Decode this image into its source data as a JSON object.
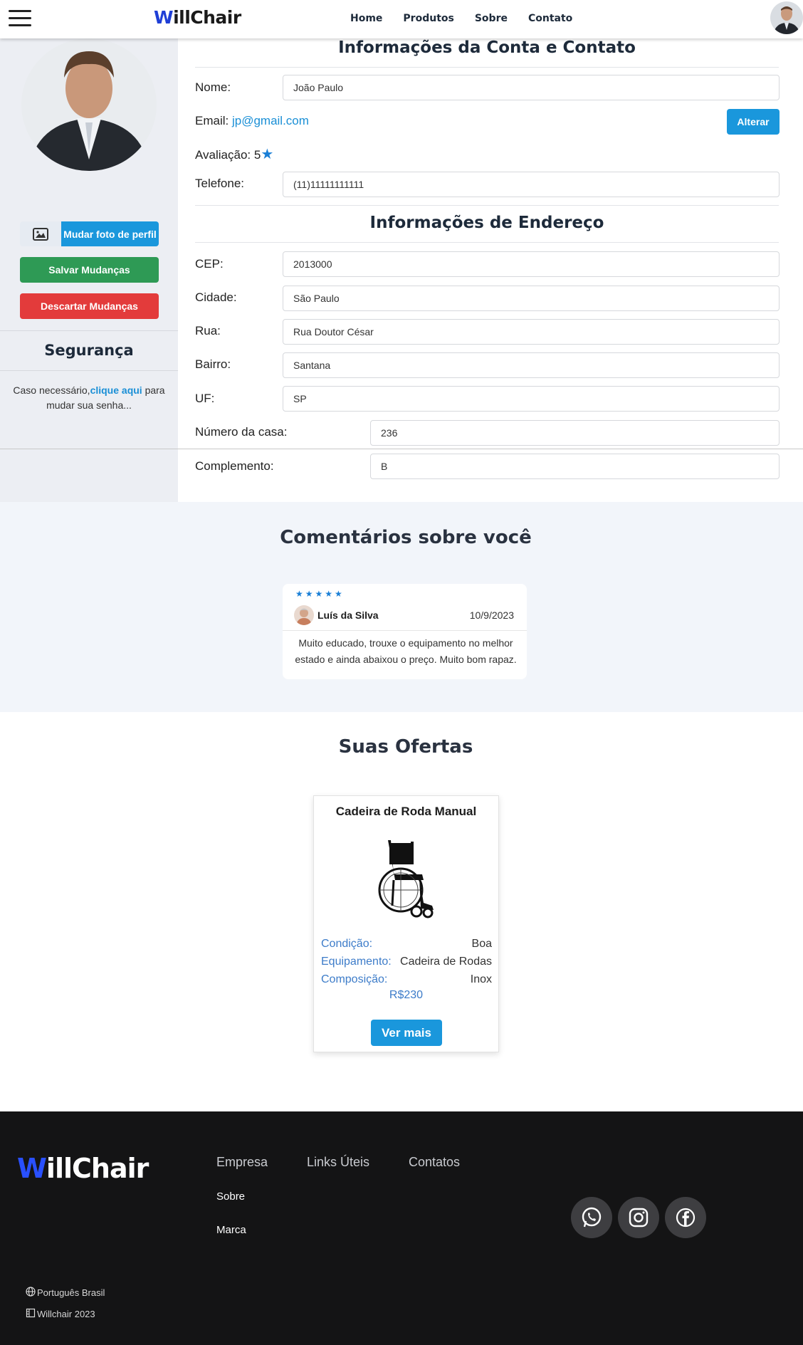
{
  "header": {
    "logo_w": "W",
    "logo_rest": "illChair",
    "nav": [
      "Home",
      "Produtos",
      "Sobre",
      "Contato"
    ]
  },
  "sidebar": {
    "change_photo_label": "Mudar foto de perfil",
    "save_label": "Salvar Mudanças",
    "discard_label": "Descartar Mudanças",
    "security_title": "Segurança",
    "security_text_before": "Caso necessário,",
    "security_link": "clique aqui",
    "security_text_after": " para mudar sua senha..."
  },
  "account": {
    "title": "Informações da Conta e Contato",
    "name_label": "Nome:",
    "name_value": "João Paulo",
    "email_label": "Email:",
    "email_value": "jp@gmail.com",
    "alter_label": "Alterar",
    "rating_label": "Avaliação: 5",
    "phone_label": "Telefone:",
    "phone_value": "(11)11111111111"
  },
  "address": {
    "title": "Informações de Endereço",
    "cep_label": "CEP:",
    "cep_value": "2013000",
    "city_label": "Cidade:",
    "city_value": "São Paulo",
    "street_label": "Rua:",
    "street_value": "Rua Doutor César",
    "district_label": "Bairro:",
    "district_value": "Santana",
    "uf_label": "UF:",
    "uf_value": "SP",
    "number_label": "Número da casa:",
    "number_value": "236",
    "complement_label": "Complemento:",
    "complement_value": "B"
  },
  "comments": {
    "title": "Comentários sobre você",
    "items": [
      {
        "stars": "★★★★★",
        "author": "Luís da Silva",
        "date": "10/9/2023",
        "text": "Muito educado, trouxe o equipamento no melhor estado e ainda abaixou o preço. Muito bom rapaz."
      }
    ]
  },
  "offers": {
    "title": "Suas Ofertas",
    "items": [
      {
        "name": "Cadeira de Roda Manual",
        "condition_label": "Condição:",
        "condition_value": "Boa",
        "equipment_label": "Equipamento:",
        "equipment_value": "Cadeira de Rodas",
        "composition_label": "Composição:",
        "composition_value": "Inox",
        "price": "R$230",
        "cta": "Ver mais"
      }
    ]
  },
  "footer": {
    "logo_w": "W",
    "logo_rest": "illChair",
    "col_company": "Empresa",
    "col_links": "Links Úteis",
    "col_contacts": "Contatos",
    "link_about": "Sobre",
    "link_brand": "Marca",
    "language": "Português Brasil",
    "copyright": "Willchair 2023"
  },
  "colors": {
    "accent": "#1a97dc",
    "save": "#2e9a55",
    "discard": "#e33b3b",
    "brand_blue": "#1f3fd6",
    "footer_bg": "#141415"
  },
  "icons": [
    "menu-icon",
    "image-icon",
    "star-icon",
    "whatsapp-icon",
    "instagram-icon",
    "facebook-icon",
    "globe-icon",
    "building-icon"
  ]
}
